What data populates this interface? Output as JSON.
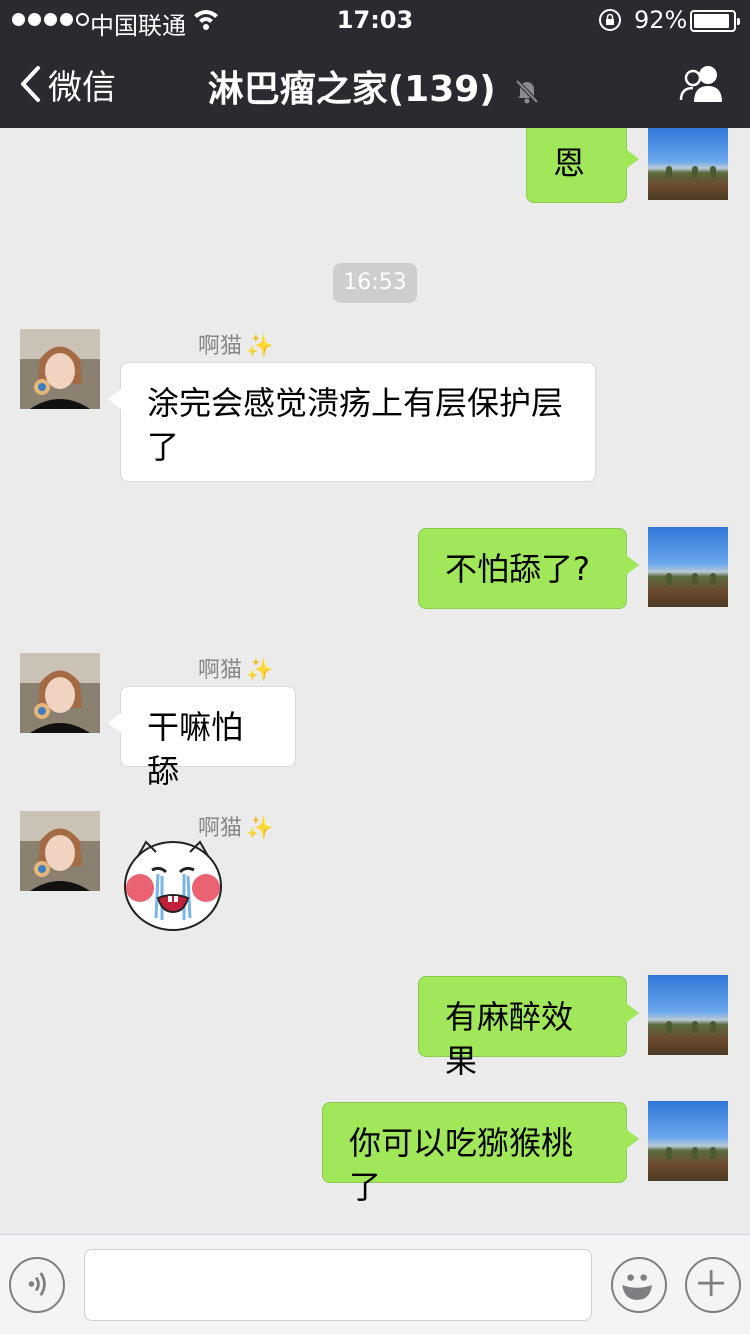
{
  "status_bar": {
    "carrier": "中国联通",
    "time": "17:03",
    "battery": "92%",
    "battery_level": 0.92
  },
  "nav": {
    "back_label": "微信",
    "title": "淋巴瘤之家(139)"
  },
  "timestamp": "16:53",
  "sender_name": "啊猫",
  "sender_decoration": "✨",
  "messages": {
    "m0": "恩",
    "m1": "涂完会感觉溃疡上有层保护层\n了",
    "m2": "不怕舔了?",
    "m3": "干嘛怕舔",
    "m5": "有麻醉效果",
    "m6": "你可以吃猕猴桃了"
  },
  "input": {
    "value": "",
    "placeholder": ""
  },
  "colors": {
    "nav_bg": "#2b2a30",
    "chat_bg": "#ebebeb",
    "outgoing_bubble": "#a0e75a",
    "incoming_bubble": "#ffffff"
  },
  "icons": {
    "back": "chevron-left-icon",
    "mute": "bell-muted-icon",
    "group": "group-people-icon",
    "voice": "voice-icon",
    "emoji": "emoji-smile-icon",
    "plus": "plus-icon"
  }
}
